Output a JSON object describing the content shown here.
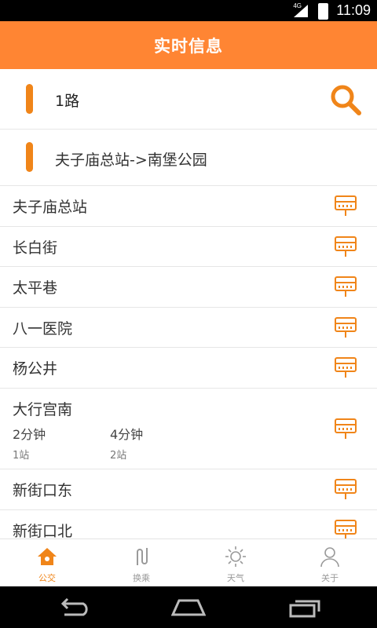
{
  "status_bar": {
    "network": "4G",
    "time": "11:09"
  },
  "header": {
    "title": "实时信息"
  },
  "route_input": {
    "value": "1路",
    "search_icon": "search-icon"
  },
  "direction": {
    "value": "夫子庙总站->南堡公园"
  },
  "stops": [
    {
      "name": "夫子庙总站"
    },
    {
      "name": "长白街"
    },
    {
      "name": "太平巷"
    },
    {
      "name": "八一医院"
    },
    {
      "name": "杨公井"
    },
    {
      "name": "大行宫南",
      "arrivals": [
        {
          "eta": "2分钟",
          "distance": "1站"
        },
        {
          "eta": "4分钟",
          "distance": "2站"
        }
      ]
    },
    {
      "name": "新街口东"
    },
    {
      "name": "新街口北"
    }
  ],
  "tabs": [
    {
      "label": "公交",
      "icon": "home-icon",
      "active": true
    },
    {
      "label": "换乘",
      "icon": "transfer-icon",
      "active": false
    },
    {
      "label": "天气",
      "icon": "sun-icon",
      "active": false
    },
    {
      "label": "关于",
      "icon": "person-icon",
      "active": false
    }
  ],
  "colors": {
    "accent": "#ff8533",
    "icon_orange": "#f08519"
  }
}
